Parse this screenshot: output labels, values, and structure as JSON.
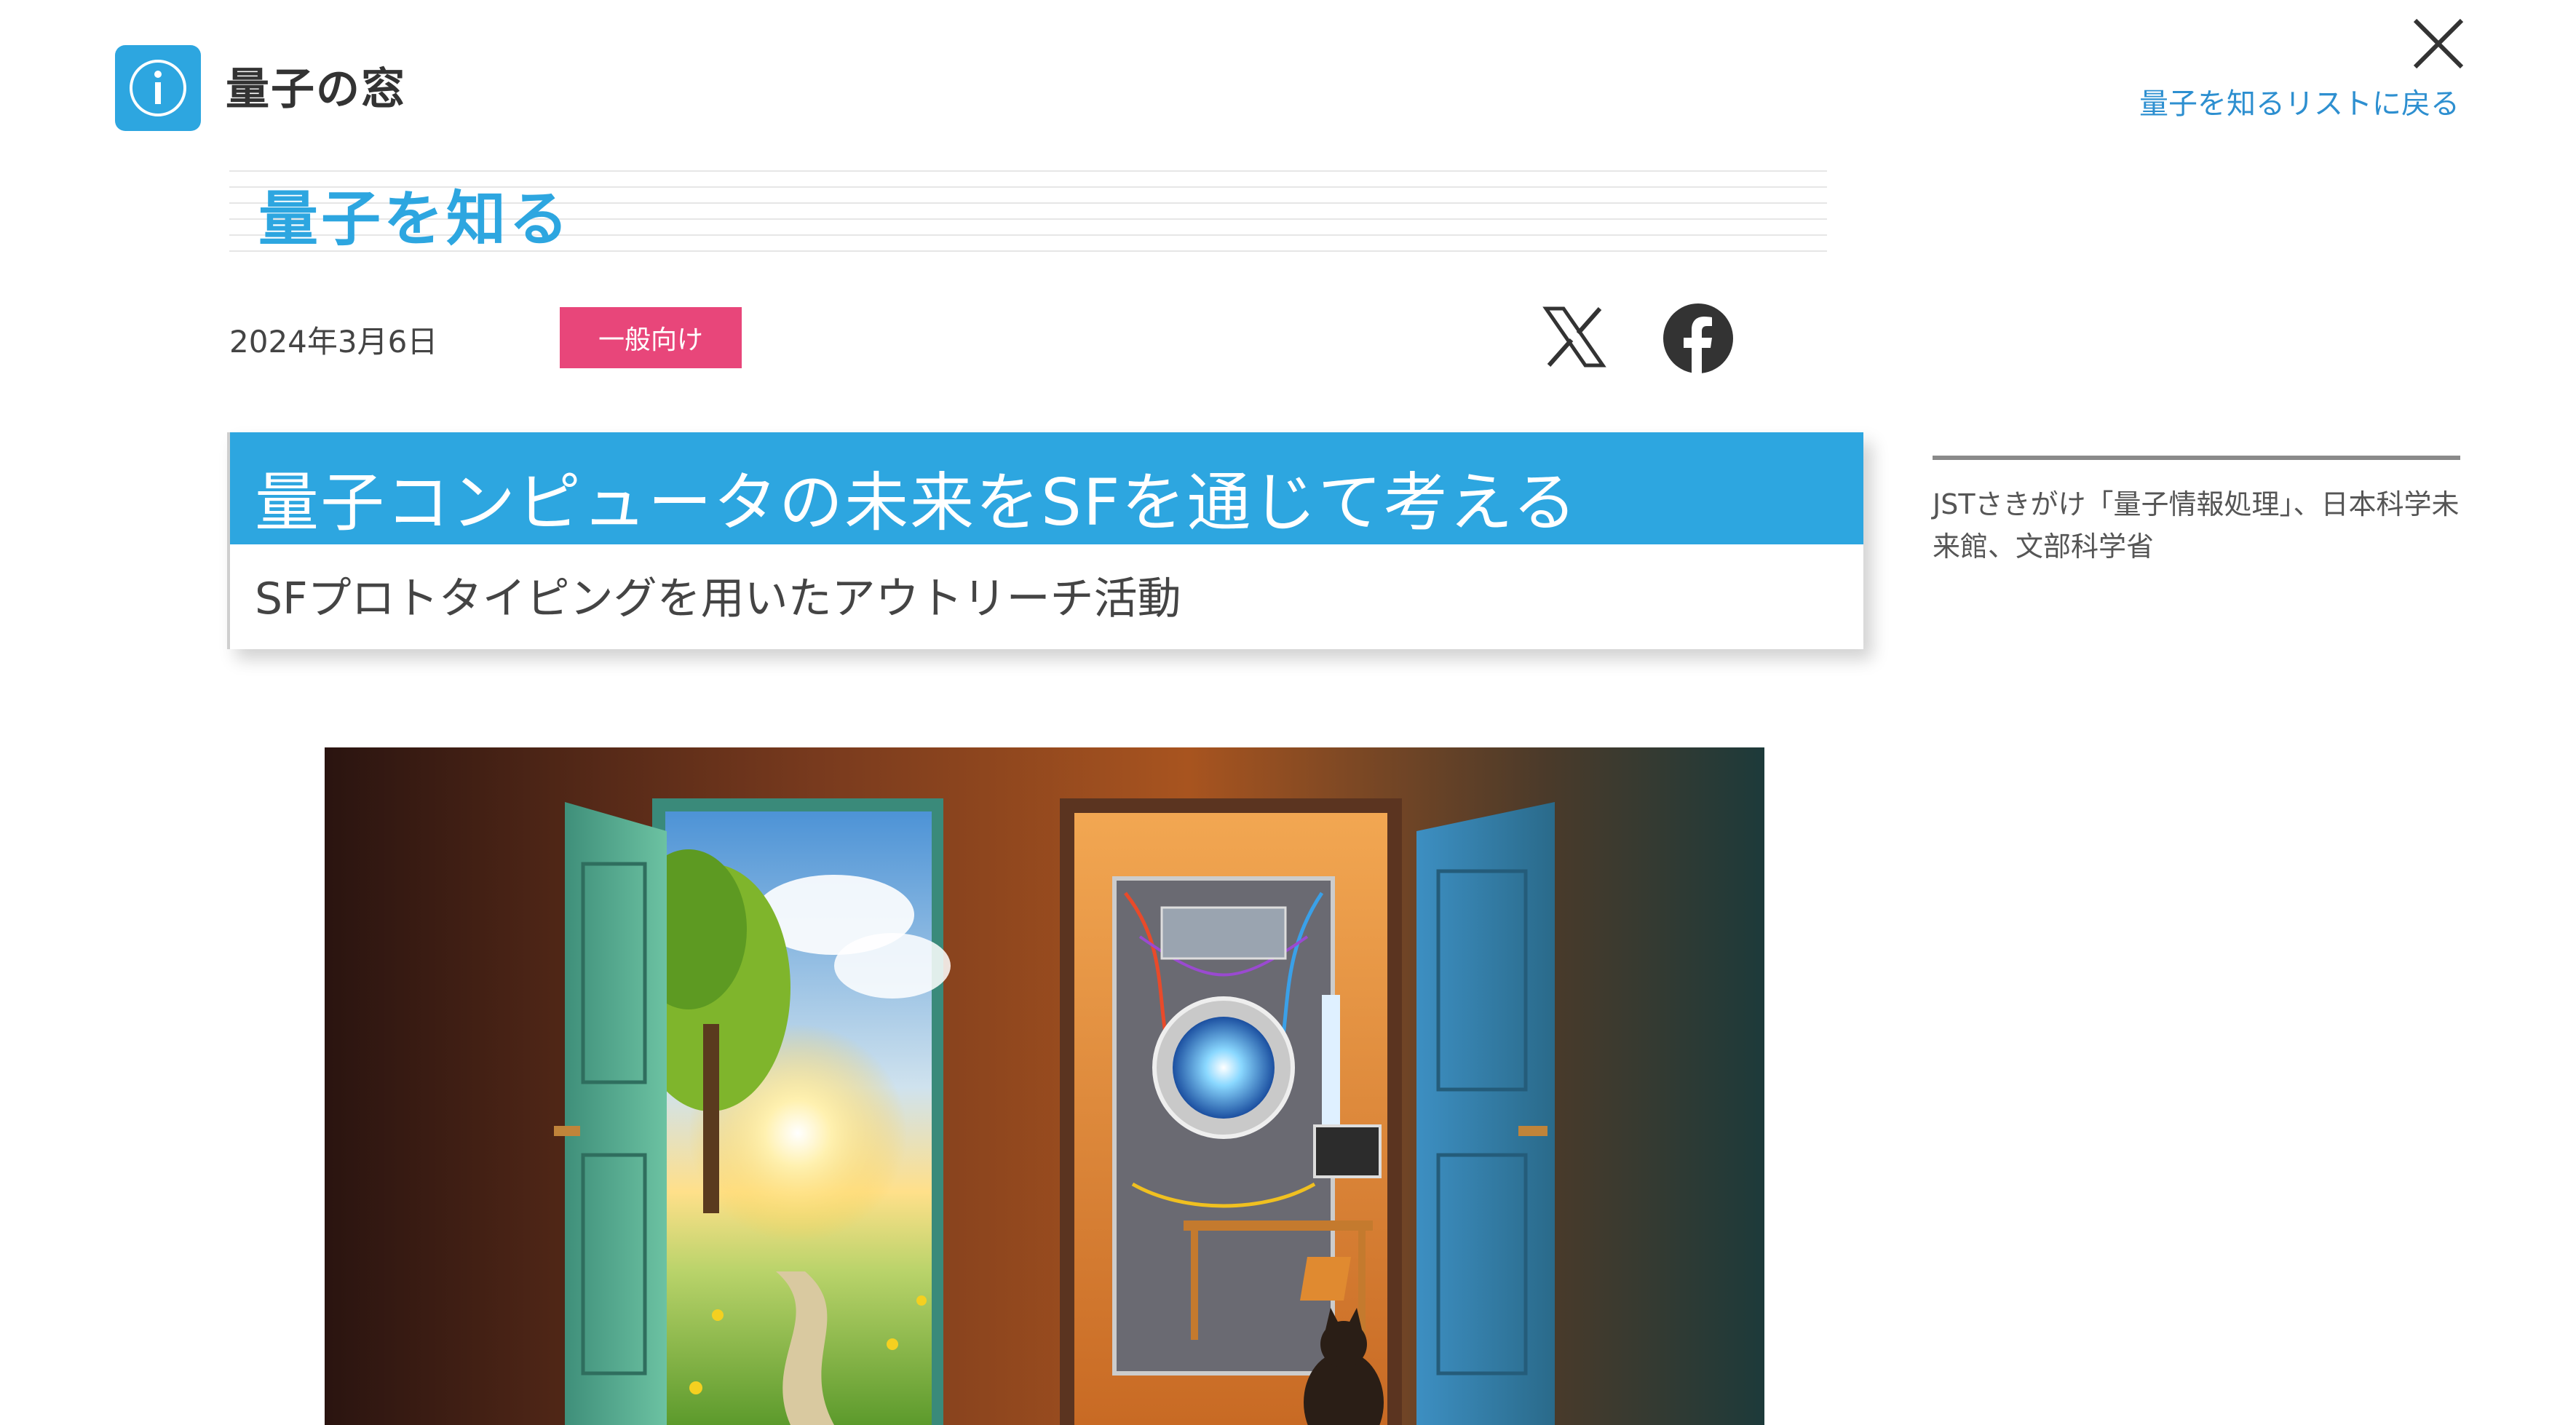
{
  "header": {
    "site_name": "量子の窓",
    "logo_icon": "info-icon",
    "close_icon": "close-icon",
    "back_link": "量子を知るリストに戻る"
  },
  "section": {
    "title": "量子を知る"
  },
  "meta": {
    "date": "2024年3月6日",
    "tag": "一般向け",
    "share_x_icon": "x-logo-icon",
    "share_facebook_icon": "facebook-icon"
  },
  "article": {
    "title": "量子コンピュータの未来をSFを通じて考える",
    "subtitle": "SFプロトタイピングを用いたアウトリーチ活動"
  },
  "sidebar": {
    "credit": "JSTさきがけ「量子情報処理」、日本科学未来館、文部科学省"
  },
  "colors": {
    "accent": "#2da6e0",
    "tag": "#e8467a",
    "link": "#2d8fd0"
  }
}
